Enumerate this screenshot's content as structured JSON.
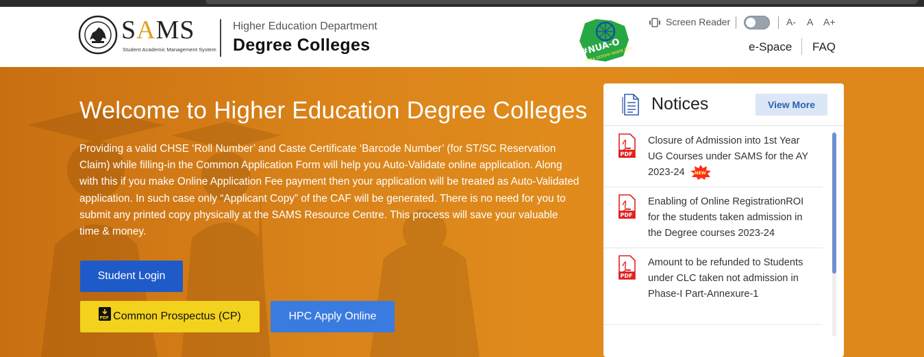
{
  "header": {
    "logo_text": "SAMS",
    "logo_subtitle": "Student Academic Management System",
    "department": "Higher Education Department",
    "college": "Degree Colleges",
    "badge_text_main": "#NUA-O",
    "badge_text_sub": "YUBA ODISHA NABIN ODISHA",
    "screen_reader": "Screen Reader",
    "font_decrease": "A-",
    "font_normal": "A",
    "font_increase": "A+",
    "nav": {
      "espace": "e-Space",
      "faq": "FAQ"
    }
  },
  "hero": {
    "title": "Welcome to Higher Education Degree Colleges",
    "description": "Providing a valid CHSE ‘Roll Number’ and Caste Certificate ‘Barcode Number’ (for ST/SC Reservation Claim) while filling-in the Common Application Form will help you Auto-Validate online application. Along with this if you make Online Application Fee payment then your application will be treated as Auto-Validated application. In such case only “Applicant Copy” of the CAF will be generated. There is no need for you to submit any printed copy physically at the SAMS Resource Centre. This process will save your valuable time & money.",
    "buttons": {
      "student_login": "Student Login",
      "common_prospectus": "Common Prospectus (CP)",
      "hpc_apply": "HPC Apply Online"
    }
  },
  "notices": {
    "title": "Notices",
    "view_more": "View More",
    "new_badge": "NEW",
    "items": [
      {
        "text": "Closure of Admission into 1st Year UG Courses under SAMS for the AY 2023-24",
        "is_new": true
      },
      {
        "text": "Enabling of Online RegistrationROI for the students taken admission in the Degree courses 2023-24",
        "is_new": false
      },
      {
        "text": "Amount to be refunded to Students under CLC taken not admission in Phase-I Part-Annexure-1",
        "is_new": false
      }
    ]
  },
  "colors": {
    "hero_orange": "#dd861a",
    "login_blue": "#1f5bc8",
    "cp_yellow": "#f2d21c",
    "hpc_blue": "#3a7be0",
    "pdf_red": "#e02020"
  },
  "icons": {
    "emblem": "odisha-emblem-icon",
    "screen_reader": "screen-reader-icon",
    "notice_doc": "document-icon",
    "pdf": "pdf-icon"
  }
}
